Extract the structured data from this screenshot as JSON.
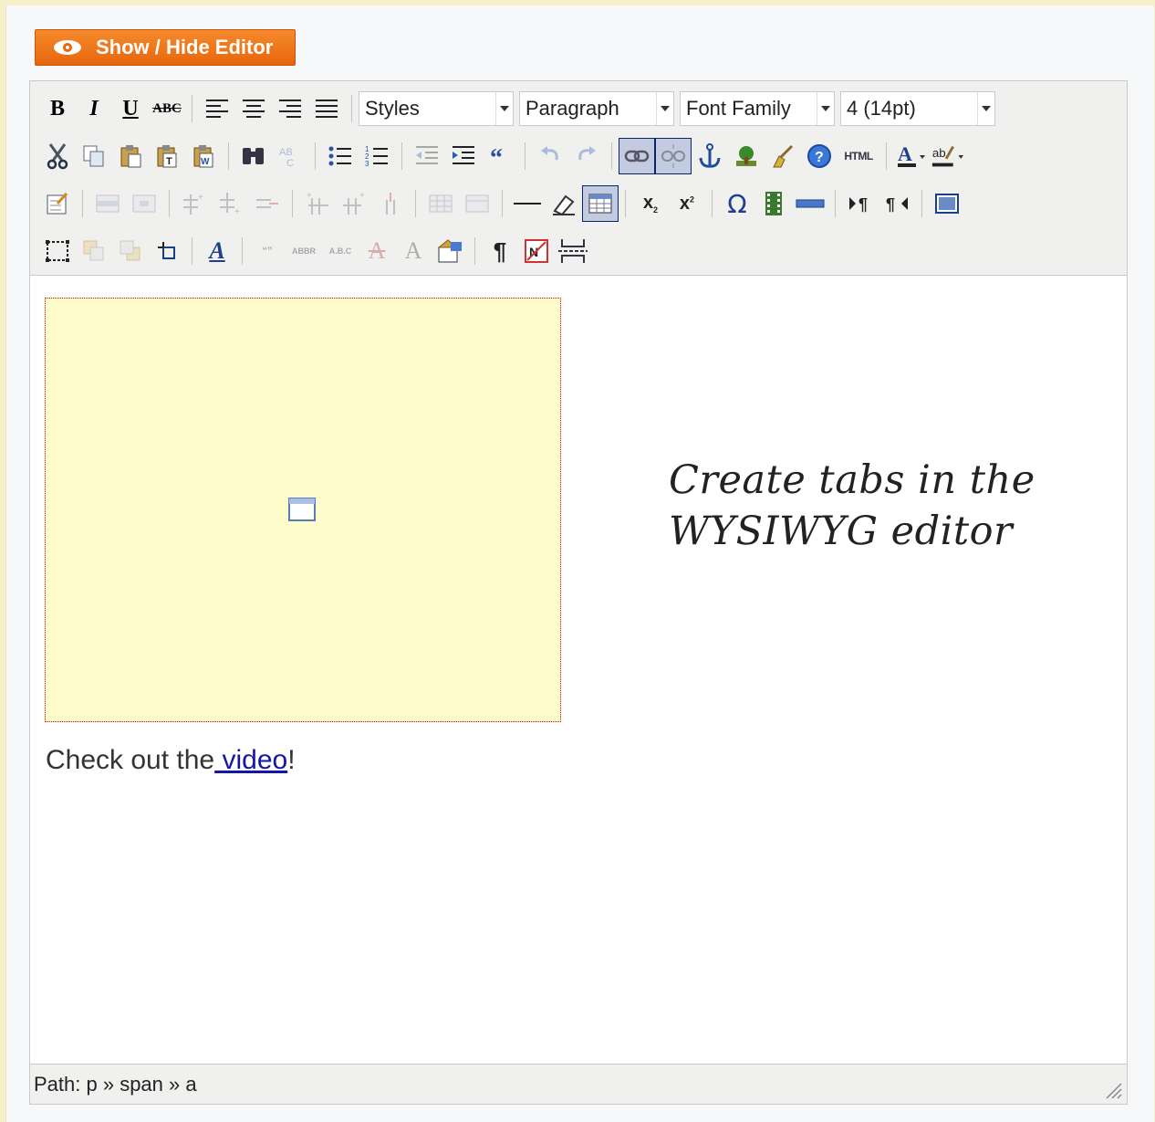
{
  "show_hide_button": {
    "label": "Show / Hide Editor",
    "icon": "eye-icon"
  },
  "toolbar": {
    "row1": {
      "bold": "B",
      "italic": "I",
      "underline": "U",
      "strikethrough": "ABC",
      "styles": "Styles",
      "format": "Paragraph",
      "font_family": "Font Family",
      "font_size": "4 (14pt)"
    },
    "row2": {
      "html_button": "HTML"
    },
    "row3": {
      "subscript": "x",
      "superscript": "x"
    },
    "row4": {
      "style_button": "A",
      "paragraph_mark": "¶"
    }
  },
  "content": {
    "caption_line1": "Create tabs in the",
    "caption_line2": "WYSIWYG editor",
    "text_before": "Check out the",
    "link_text": "video",
    "text_after": "!"
  },
  "statusbar": {
    "path_label": "Path:",
    "path": "p » span » a"
  },
  "colors": {
    "page_background": "#f6f0c8",
    "button_orange": "#ee7418",
    "toolbar_background": "#f0f0ee",
    "tabs_placeholder": "#fffccc",
    "link": "#1515a8"
  }
}
